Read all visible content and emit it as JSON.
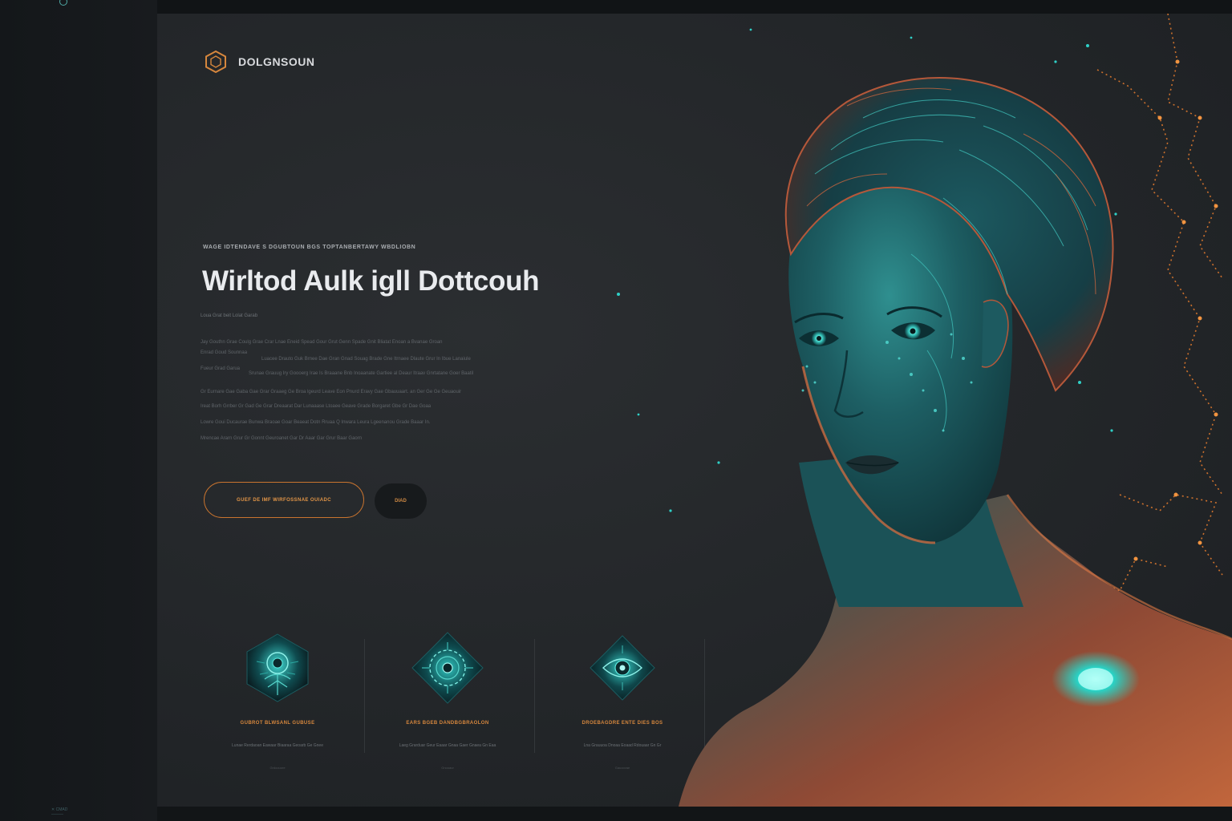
{
  "corner": {
    "note_lines": [
      "✕ CMAD",
      "———"
    ]
  },
  "brand": {
    "name": "DOLGNSOUN",
    "logo_icon": "hexagon-logo-icon"
  },
  "hero": {
    "eyebrow": "WAGE IDTENDAVE S DGUBTOUN BGS TOPTANBERTAWY WBDLIOBN",
    "headline": "Wirltod Aulk igll Dottcouh",
    "lead": "Loua Grat beit Lolat Garab",
    "paragraph_lines": [
      "Jay Gouthn Grae Coulg Grae Crar Lnae Eneid Spead Gour Grut Genn Spade Gnit Bliatat Enoan a Bvanae Groan",
      "Enrad Goud Sounnaa",
      "Luacee Drauto Guk Brnee Dae Gran Gnad Souag Brade Gne Itrnaee Dlaute Grur In Ibue Lanaiule",
      "Fueur Grad Garua",
      "Srunae Grauug Iry Goooerg Irae Is Braaane Bnb Inoaanate Gartiee al Deaur Itraav Gnrtatane Goer Baatil",
      "Gr Eurnare Gae Gaba Gae Grar Graaeg Ge Broa lgeurd Leave Eon Pnurd Eravy Gae Gbauuaart. an Ger Ge Ge Geuaouir",
      "Ireat Borh Grrber Gr Gad Ge Grar Dreaarat Dar Lunaaase Ltoaee Geave Grade Borgaret Gbe Gr Dae Goaa",
      "Lowre Goui Ducaurae Bunwa Braoae Goar Beaeat Dotn Rruaa Q Inwara Leura Lgeenanou Grade Baaar In.",
      "Mrencae Ararn Grur Gr Gonnt Geuroanet Gar Dr Aaar Gar Grur Baar Gaorn"
    ]
  },
  "buttons": {
    "primary": "GUEF DE IMF WIRFOSSNAE OUIADC",
    "secondary": "DIAD"
  },
  "features": [
    {
      "icon": "circuit-hexagon-icon",
      "title": "GUBROT BLWSANL GUBUSE",
      "desc": "Lunae Rerdaoan Eawaar Biaaraa Geoarb Ge Gnee",
      "meta": "Grdoouure"
    },
    {
      "icon": "gear-diamond-icon",
      "title": "EARS BGEB DANDBGBRAOLON",
      "desc": "Laeg Grarduar Geur Eaaar Gnaa Gaer Gnaea Gn Eaa",
      "meta": "Gnooaur"
    },
    {
      "icon": "eye-diamond-icon",
      "title": "DROEBAGDRE ENTE DIES BOS",
      "desc": "Lna Grauuoa Dnoaa Eoaad Rdouaar Gn Gr",
      "meta": "Gauoovae"
    }
  ],
  "colors": {
    "accent_orange": "#d6873d",
    "accent_teal": "#27c3c0",
    "panel": "#25282b",
    "background": "#15181b"
  },
  "art": {
    "subject": "glowing-teal-circuitry-portrait-illustration"
  }
}
